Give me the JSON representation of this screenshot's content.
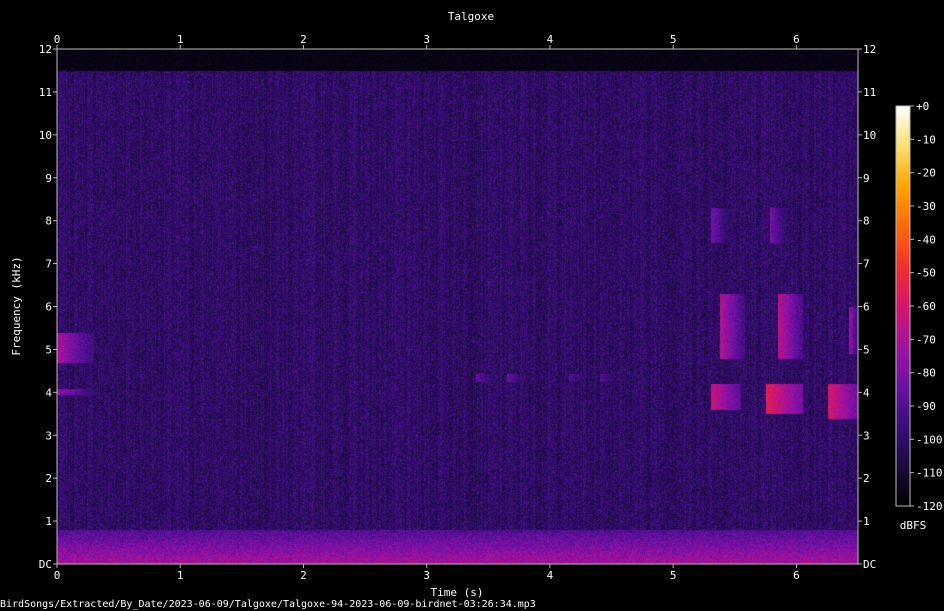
{
  "chart_data": {
    "type": "heatmap",
    "title": "Talgoxe",
    "xlabel": "Time (s)",
    "ylabel": "Frequency (kHz)",
    "xlim": [
      0,
      6.5
    ],
    "ylim": [
      0,
      12
    ],
    "x_ticks": [
      "0",
      "1",
      "2",
      "3",
      "4",
      "5",
      "6"
    ],
    "y_ticks": [
      "DC",
      "1",
      "2",
      "3",
      "4",
      "5",
      "6",
      "7",
      "8",
      "9",
      "10",
      "11",
      "12"
    ],
    "colorbar": {
      "label": "dBFS",
      "range": [
        -120,
        0
      ],
      "ticks": [
        "+0",
        "-10",
        "-20",
        "-30",
        "-40",
        "-50",
        "-60",
        "-70",
        "-80",
        "-90",
        "-100",
        "-110",
        "-120"
      ],
      "colormap": [
        "#000000",
        "#1a0b3d",
        "#3a0e7a",
        "#6a10a6",
        "#a0129e",
        "#d4146b",
        "#f2302b",
        "#ff6a0a",
        "#ffa500",
        "#ffe070",
        "#ffffff"
      ]
    },
    "background_level_db": -100,
    "noise_cutoff_khz": 11.5,
    "low_frequency_band": {
      "from_khz": 0,
      "to_khz": 0.8,
      "level_db": -70
    },
    "events": [
      {
        "t_start": 0.0,
        "t_end": 0.3,
        "f_low": 4.7,
        "f_high": 5.4,
        "level_db": -70
      },
      {
        "t_start": 0.0,
        "t_end": 0.35,
        "f_low": 3.95,
        "f_high": 4.1,
        "level_db": -75
      },
      {
        "t_start": 3.4,
        "t_end": 3.6,
        "f_low": 4.25,
        "f_high": 4.45,
        "level_db": -85
      },
      {
        "t_start": 3.65,
        "t_end": 3.85,
        "f_low": 4.25,
        "f_high": 4.45,
        "level_db": -85
      },
      {
        "t_start": 4.15,
        "t_end": 4.35,
        "f_low": 4.25,
        "f_high": 4.45,
        "level_db": -88
      },
      {
        "t_start": 4.4,
        "t_end": 4.6,
        "f_low": 4.25,
        "f_high": 4.45,
        "level_db": -88
      },
      {
        "t_start": 5.3,
        "t_end": 5.55,
        "f_low": 3.6,
        "f_high": 4.2,
        "level_db": -62
      },
      {
        "t_start": 5.38,
        "t_end": 5.58,
        "f_low": 4.8,
        "f_high": 6.3,
        "level_db": -68
      },
      {
        "t_start": 5.3,
        "t_end": 5.48,
        "f_low": 7.5,
        "f_high": 8.3,
        "level_db": -80
      },
      {
        "t_start": 5.75,
        "t_end": 6.05,
        "f_low": 3.5,
        "f_high": 4.2,
        "level_db": -55
      },
      {
        "t_start": 5.85,
        "t_end": 6.05,
        "f_low": 4.8,
        "f_high": 6.3,
        "level_db": -66
      },
      {
        "t_start": 5.78,
        "t_end": 5.95,
        "f_low": 7.5,
        "f_high": 8.3,
        "level_db": -80
      },
      {
        "t_start": 6.25,
        "t_end": 6.5,
        "f_low": 3.4,
        "f_high": 4.2,
        "level_db": -58
      },
      {
        "t_start": 6.42,
        "t_end": 6.5,
        "f_low": 4.9,
        "f_high": 6.0,
        "level_db": -72
      }
    ],
    "grid": false,
    "legend": "colorbar right"
  },
  "footer": {
    "filename": "BirdSongs/Extracted/By_Date/2023-06-09/Talgoxe/Talgoxe-94-2023-06-09-birdnet-03:26:34.mp3"
  }
}
